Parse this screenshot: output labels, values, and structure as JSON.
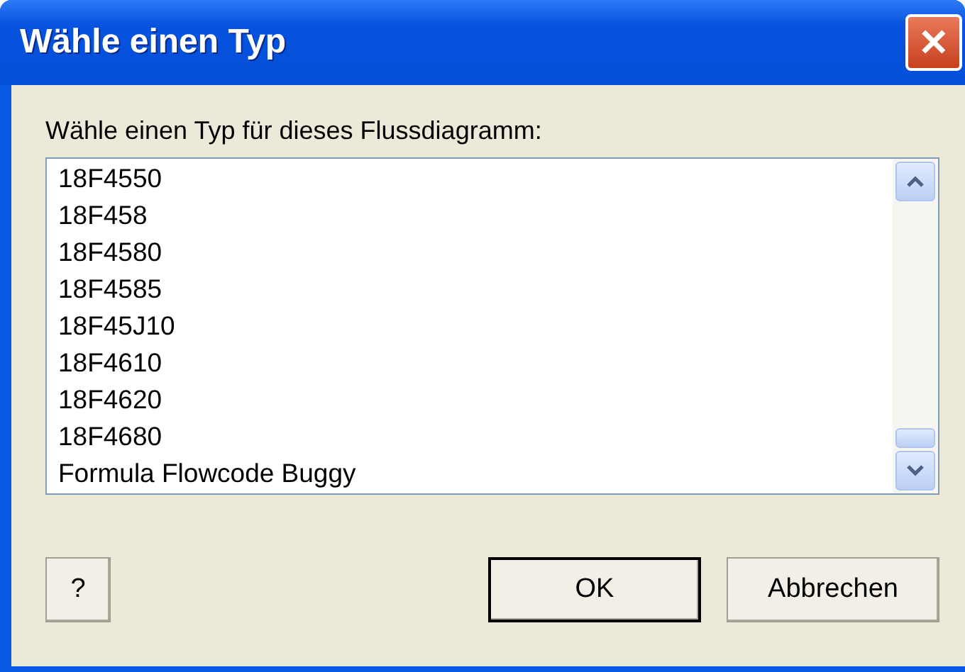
{
  "window": {
    "title": "Wähle einen Typ",
    "close": "✕"
  },
  "prompt": "Wähle einen Typ für dieses Flussdiagramm:",
  "list": {
    "items": [
      "18F4550",
      "18F458",
      "18F4580",
      "18F4585",
      "18F45J10",
      "18F4610",
      "18F4620",
      "18F4680",
      "Formula Flowcode Buggy"
    ]
  },
  "buttons": [
    {
      "label": "?",
      "kind": "help",
      "default": false
    },
    {
      "label": "OK",
      "kind": "action",
      "default": true
    },
    {
      "label": "Abbrechen",
      "kind": "action",
      "default": false
    }
  ]
}
